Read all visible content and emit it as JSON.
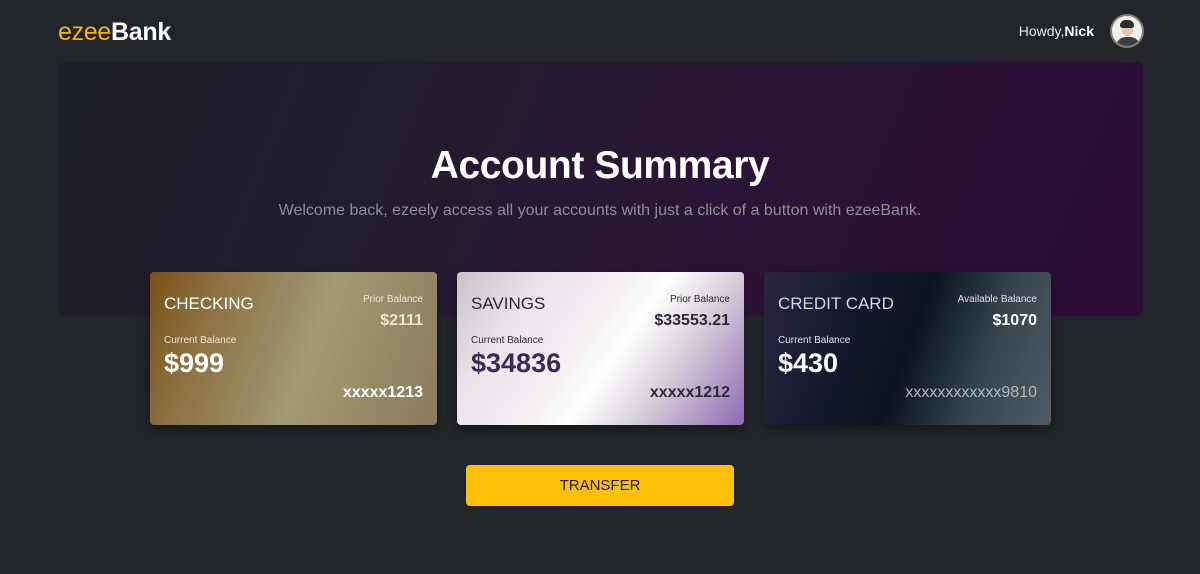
{
  "header": {
    "logo_accent": "ezee",
    "logo_main": "Bank",
    "greeting_prefix": "Howdy,",
    "user_name": "Nick"
  },
  "hero": {
    "title": "Account Summary",
    "subtitle": "Welcome back, ezeely access all your accounts with just a click of a button with ezeeBank."
  },
  "accounts": [
    {
      "name": "CHECKING",
      "prior_label": "Prior Balance",
      "prior_value": "$2111",
      "current_label": "Current Balance",
      "current_value": "$999",
      "number": "xxxxx1213"
    },
    {
      "name": "SAVINGS",
      "prior_label": "Prior Balance",
      "prior_value": "$33553.21",
      "current_label": "Current Balance",
      "current_value": "$34836",
      "number": "xxxxx1212"
    },
    {
      "name": "CREDIT CARD",
      "prior_label": "Available Balance",
      "prior_value": "$1070",
      "current_label": "Current Balance",
      "current_value": "$430",
      "number": "xxxxxxxxxxxx9810"
    }
  ],
  "actions": {
    "transfer_label": "TRANSFER"
  },
  "colors": {
    "background": "#212428",
    "accent": "#fec107",
    "logo_accent": "#f5b50a"
  }
}
